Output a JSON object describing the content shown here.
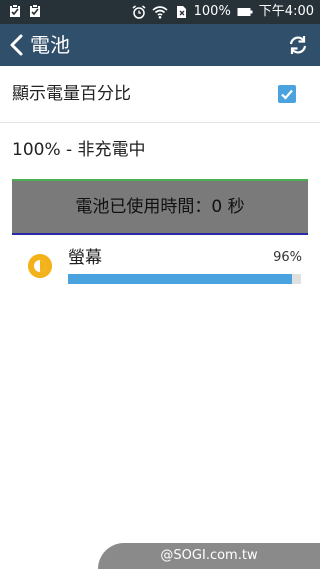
{
  "status_bar": {
    "battery_percent": "100%",
    "time": "下午4:00"
  },
  "app_bar": {
    "title": "電池"
  },
  "settings": {
    "show_percentage_label": "顯示電量百分比",
    "show_percentage_checked": true
  },
  "battery": {
    "status_text": "100% - 非充電中",
    "usage_time_text": "電池已使用時間：0 秒"
  },
  "usage_items": [
    {
      "name": "螢幕",
      "percent_text": "96%",
      "percent": 0.96,
      "icon": "brightness-icon"
    }
  ],
  "watermark": "@SOGI.com.tw",
  "colors": {
    "status_bar": "#263238",
    "app_bar": "#2f4f6b",
    "accent": "#4aa3df",
    "usage_box": "#7a7a7a"
  }
}
